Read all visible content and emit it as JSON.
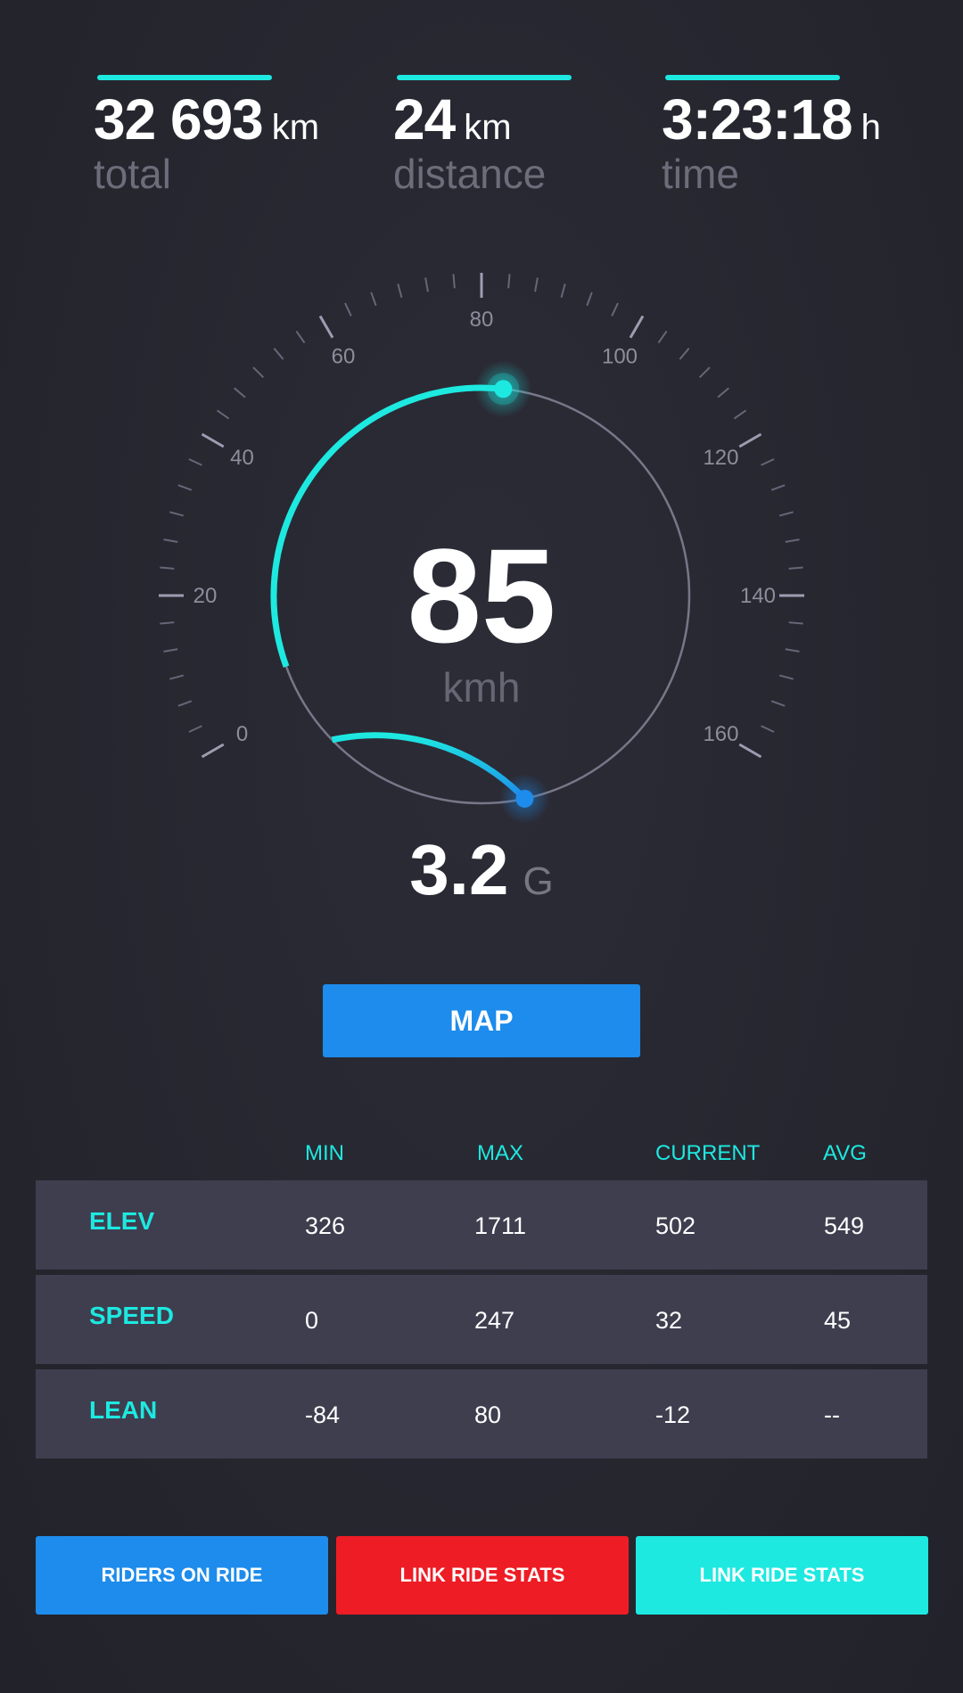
{
  "stats": {
    "total": {
      "value": "32 693",
      "unit": "km",
      "label": "total"
    },
    "distance": {
      "value": "24",
      "unit": "km",
      "label": "distance"
    },
    "time": {
      "value": "3:23:18",
      "unit": "h",
      "label": "time"
    }
  },
  "gauge": {
    "min": 0,
    "max": 160,
    "tick_labels": [
      "0",
      "20",
      "40",
      "60",
      "80",
      "100",
      "120",
      "140",
      "160"
    ],
    "speed": 85,
    "speed_label": "85",
    "speed_unit": "kmh",
    "g_value": "3.2",
    "g_unit": "G"
  },
  "map_button": {
    "label": "MAP"
  },
  "table": {
    "headers": [
      "MIN",
      "MAX",
      "CURRENT",
      "AVG"
    ],
    "rows": [
      {
        "name": "ELEV",
        "min": "326",
        "max": "1711",
        "current": "502",
        "avg": "549"
      },
      {
        "name": "SPEED",
        "min": "0",
        "max": "247",
        "current": "32",
        "avg": "45"
      },
      {
        "name": "LEAN",
        "min": "-84",
        "max": "80",
        "current": "-12",
        "avg": "--"
      }
    ]
  },
  "buttons": [
    {
      "label": "RIDERS ON RIDE",
      "color": "#1d8cec"
    },
    {
      "label": "LINK RIDE STATS",
      "color": "#ee1c25"
    },
    {
      "label": "LINK RIDE STATS",
      "color": "#1de9e0"
    }
  ],
  "colors": {
    "accent": "#1de9e0",
    "blue": "#1d8cec",
    "red": "#ee1c25",
    "background": "#26262f"
  }
}
